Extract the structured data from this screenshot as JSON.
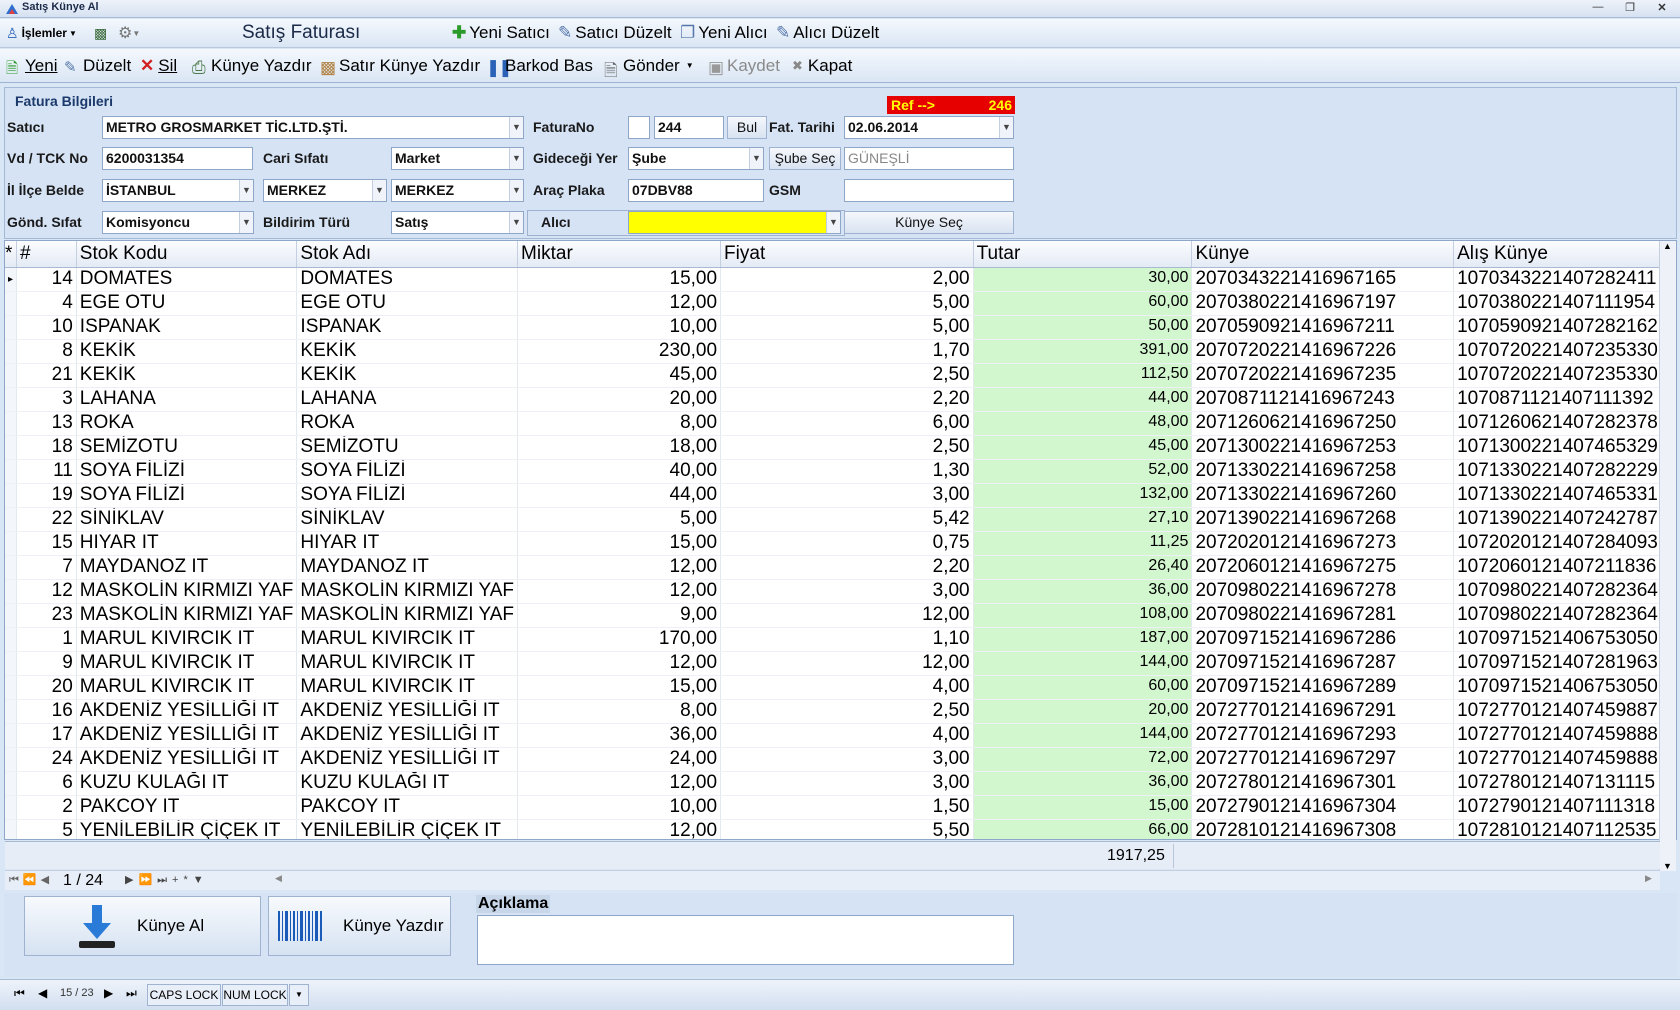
{
  "window": {
    "title": "Satış Künye Al"
  },
  "menubar": {
    "islemler": "İşlemler",
    "form_title": "Satış Faturası",
    "yeni_satici": "Yeni Satıcı",
    "satici_duzelt": "Satıcı Düzelt",
    "yeni_alici": "Yeni Alıcı",
    "alici_duzelt": "Alıcı Düzelt"
  },
  "toolbar": {
    "yeni": "Yeni",
    "duzelt": "Düzelt",
    "sil": "Sil",
    "kunye_yazdir": "Künye Yazdır",
    "satir_kunye_yazdir": "Satır Künye Yazdır",
    "barkod_bas": "Barkod Bas",
    "gonder": "Gönder",
    "kaydet": "Kaydet",
    "kapat": "Kapat"
  },
  "fatura": {
    "group_title": "Fatura Bilgileri",
    "ref_label": "Ref -->",
    "ref_value": "246",
    "satici_label": "Satıcı",
    "satici_value": "METRO GROSMARKET TİC.LTD.ŞTİ.",
    "vd_label": "Vd / TCK No",
    "vd_value": "6200031354",
    "cari_sifati_label": "Cari Sıfatı",
    "cari_sifati_value": "Market",
    "il_label": "İl İlçe Belde",
    "il_value": "İSTANBUL",
    "ilce_value": "MERKEZ",
    "belde_value": "MERKEZ",
    "gond_sifat_label": "Gönd. Sıfat",
    "gond_sifat_value": "Komisyoncu",
    "bildirim_label": "Bildirim Türü",
    "bildirim_value": "Satış",
    "faturano_label": "FaturaNo",
    "faturano_prefix": "",
    "faturano_value": "244",
    "bul_button": "Bul",
    "tarih_label": "Fat. Tarihi",
    "tarih_value": "02.06.2014",
    "gidecegi_label": "Gideceği Yer",
    "gidecegi_value": "Şube",
    "sube_sec_button": "Şube Seç",
    "sube_value": "GÜNEŞLİ",
    "plaka_label": "Araç Plaka",
    "plaka_value": "07DBV88",
    "gsm_label": "GSM",
    "gsm_value": "",
    "alici_label": "Alıcı",
    "alici_value": "",
    "kunye_sec_button": "Künye Seç"
  },
  "grid": {
    "columns": [
      "#",
      "Stok Kodu",
      "Stok Adı",
      "Miktar",
      "Fiyat",
      "Tutar",
      "Künye",
      "Alış Künye"
    ],
    "rows": [
      [
        "14",
        "DOMATES",
        "DOMATES",
        "15,00",
        "2,00",
        "30,00",
        "207034322141696716 5",
        "107034322140728241 1"
      ],
      [
        "4",
        "EGE OTU",
        "EGE OTU",
        "12,00",
        "5,00",
        "60,00",
        "207038022141696719 7",
        "107038022140711195 4"
      ],
      [
        "10",
        "ISPANAK",
        "ISPANAK",
        "10,00",
        "5,00",
        "50,00",
        "207059092141696721 1",
        "107059092140728216 2"
      ],
      [
        "8",
        "KEKİK",
        "KEKİK",
        "230,00",
        "1,70",
        "391,00",
        "207072022141696722 6",
        "107072022140723533 0"
      ],
      [
        "21",
        "KEKİK",
        "KEKİK",
        "45,00",
        "2,50",
        "112,50",
        "207072022141696723 5",
        "107072022140723533 0"
      ],
      [
        "3",
        "LAHANA",
        "LAHANA",
        "20,00",
        "2,20",
        "44,00",
        "207087112141696724 3",
        "107087112140711139 2"
      ],
      [
        "13",
        "ROKA",
        "ROKA",
        "8,00",
        "6,00",
        "48,00",
        "207126062141696725 0",
        "107126062140728237 8"
      ],
      [
        "18",
        "SEMİZOTU",
        "SEMİZOTU",
        "18,00",
        "2,50",
        "45,00",
        "207130022141696725 3",
        "107130022140746532 9"
      ],
      [
        "11",
        "SOYA FİLİZİ",
        "SOYA FİLİZİ",
        "40,00",
        "1,30",
        "52,00",
        "207133022141696725 8",
        "107133022140728222 9"
      ],
      [
        "19",
        "SOYA FİLİZİ",
        "SOYA FİLİZİ",
        "44,00",
        "3,00",
        "132,00",
        "207133022141696726 0",
        "107133022140746533 1"
      ],
      [
        "22",
        "SİNİKLAV",
        "SİNİKLAV",
        "5,00",
        "5,42",
        "27,10",
        "207139022141696726 8",
        "107139022140724278 7"
      ],
      [
        "15",
        "HIYAR  IT",
        "HIYAR  IT",
        "15,00",
        "0,75",
        "11,25",
        "207202012141696727 3",
        "107202012140728409 3"
      ],
      [
        "7",
        "MAYDANOZ  IT",
        "MAYDANOZ  IT",
        "12,00",
        "2,20",
        "26,40",
        "207206012141696727 5",
        "107206012140721183 6"
      ],
      [
        "12",
        "MASKOLİN KIRMIZI YAF",
        "MASKOLİN KIRMIZI YAF",
        "12,00",
        "3,00",
        "36,00",
        "207098022141696727 8",
        "107098022140728236 4"
      ],
      [
        "23",
        "MASKOLİN KIRMIZI YAF",
        "MASKOLİN KIRMIZI YAF",
        "9,00",
        "12,00",
        "108,00",
        "207098022141696728 1",
        "107098022140728236 4"
      ],
      [
        "1",
        "MARUL KIVIRCIK  IT",
        "MARUL KIVIRCIK  IT",
        "170,00",
        "1,10",
        "187,00",
        "207097152141696728 6",
        "107097152140675305 0"
      ],
      [
        "9",
        "MARUL KIVIRCIK  IT",
        "MARUL KIVIRCIK  IT",
        "12,00",
        "12,00",
        "144,00",
        "207097152141696728 7",
        "107097152140728196 3"
      ],
      [
        "20",
        "MARUL KIVIRCIK  IT",
        "MARUL KIVIRCIK  IT",
        "15,00",
        "4,00",
        "60,00",
        "207097152141696728 9",
        "107097152140675305 0"
      ],
      [
        "16",
        "AKDENİZ YESİLLİĞİ  IT",
        "AKDENİZ YESİLLİĞİ  IT",
        "8,00",
        "2,50",
        "20,00",
        "207277012141696729 1",
        "107277012140745988 7"
      ],
      [
        "17",
        "AKDENİZ YESİLLİĞİ  IT",
        "AKDENİZ YESİLLİĞİ  IT",
        "36,00",
        "4,00",
        "144,00",
        "207277012141696729 3",
        "107277012140745988 8"
      ],
      [
        "24",
        "AKDENİZ YESİLLİĞİ  IT",
        "AKDENİZ YESİLLİĞİ  IT",
        "24,00",
        "3,00",
        "72,00",
        "207277012141696729 7",
        "107277012140745988 8"
      ],
      [
        "6",
        "KUZU KULAĞI  IT",
        "KUZU KULAĞI  IT",
        "12,00",
        "3,00",
        "36,00",
        "207278012141696730 1",
        "107278012140713111 5"
      ],
      [
        "2",
        "PAKCOY  IT",
        "PAKCOY  IT",
        "10,00",
        "1,50",
        "15,00",
        "207279012141696730 4",
        "107279012140711131 8"
      ],
      [
        "5",
        "YENİLEBİLİR ÇİÇEK  IT",
        "YENİLEBİLİR ÇİÇEK  IT",
        "12,00",
        "5,50",
        "66,00",
        "207281012141696730 8",
        "107281012140711253 5"
      ]
    ],
    "total": "1917,25",
    "pager": "1 / 24"
  },
  "bottom": {
    "kunye_al": "Künye Al",
    "kunye_yazdir": "Künye Yazdır",
    "aciklama_label": "Açıklama",
    "aciklama_value": ""
  },
  "status": {
    "record": "15 / 23",
    "caps": "CAPS LOCK",
    "num": "NUM LOCK"
  }
}
